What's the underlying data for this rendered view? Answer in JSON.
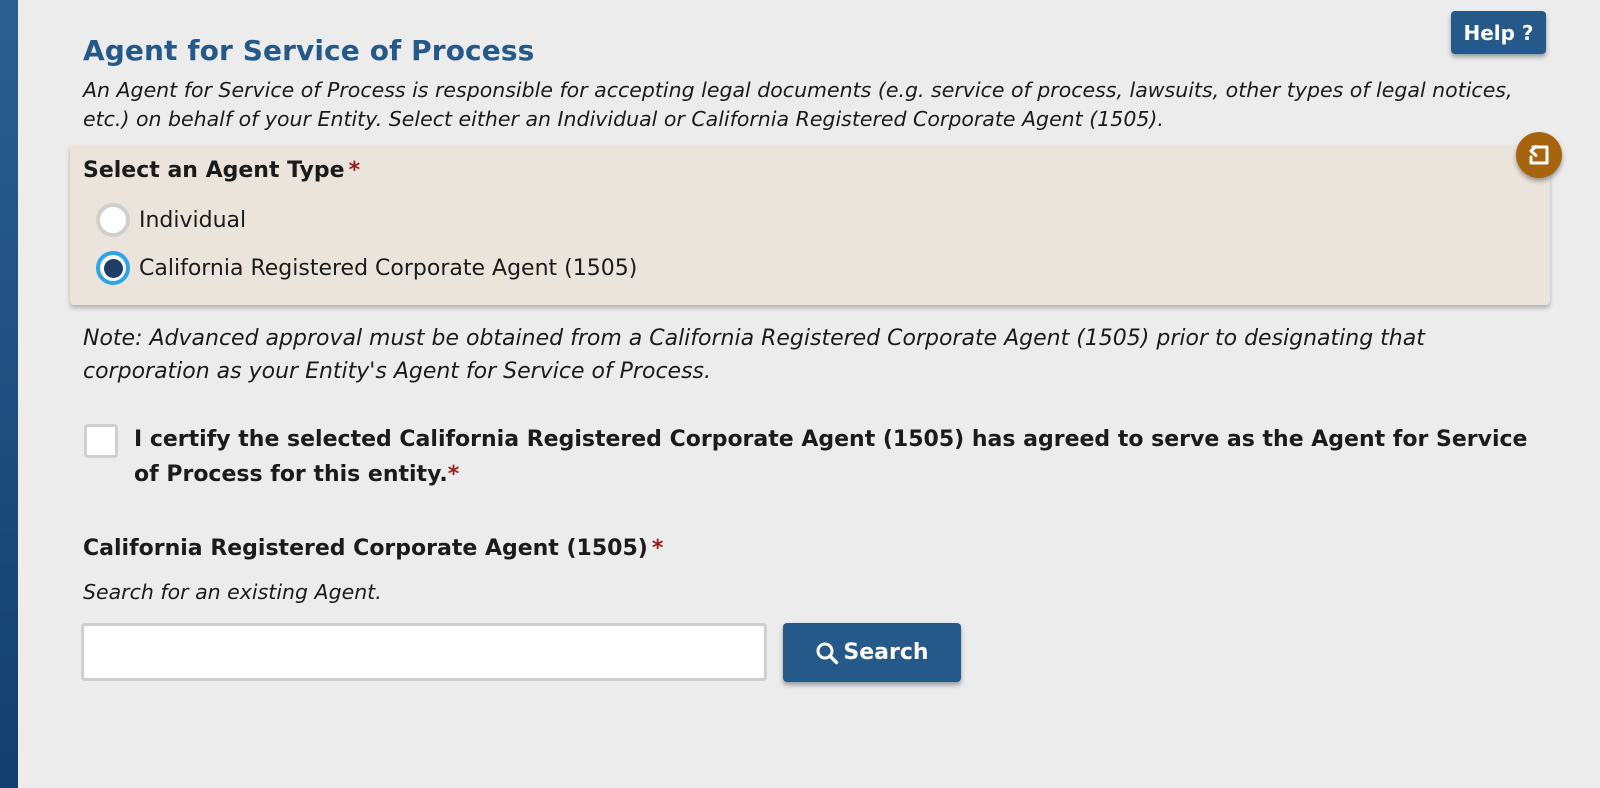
{
  "help": {
    "label": "Help ?"
  },
  "section": {
    "title": "Agent for Service of Process",
    "description": "An Agent for Service of Process is responsible for accepting legal documents (e.g. service of process, lawsuits, other types of legal notices, etc.) on behalf of your Entity. Select either an Individual or California Registered Corporate Agent (1505)."
  },
  "agent_type": {
    "label": "Select an Agent Type",
    "required_mark": "*",
    "options": [
      {
        "label": "Individual",
        "selected": false
      },
      {
        "label": "California Registered Corporate Agent (1505)",
        "selected": true
      }
    ]
  },
  "note": "Note: Advanced approval must be obtained from a California Registered Corporate Agent (1505) prior to designating that corporation as your Entity's Agent for Service of Process.",
  "certify": {
    "label": "I certify the selected California Registered Corporate Agent (1505) has agreed to serve as the Agent for Service of Process for this entity.",
    "required_mark": "*",
    "checked": false
  },
  "corporate_agent": {
    "label": "California Registered Corporate Agent (1505)",
    "required_mark": "*",
    "helper": "Search for an existing Agent.",
    "input_value": "",
    "search_label": "Search"
  },
  "colors": {
    "primary": "#25598a",
    "panel_bg": "#ebe4dc",
    "undo_button": "#a8640d",
    "required": "#9b1c1c",
    "radio_focus": "#2ba4e8",
    "page_bg": "#ececec"
  },
  "icons": {
    "undo": "undo-icon",
    "search": "search-icon"
  }
}
